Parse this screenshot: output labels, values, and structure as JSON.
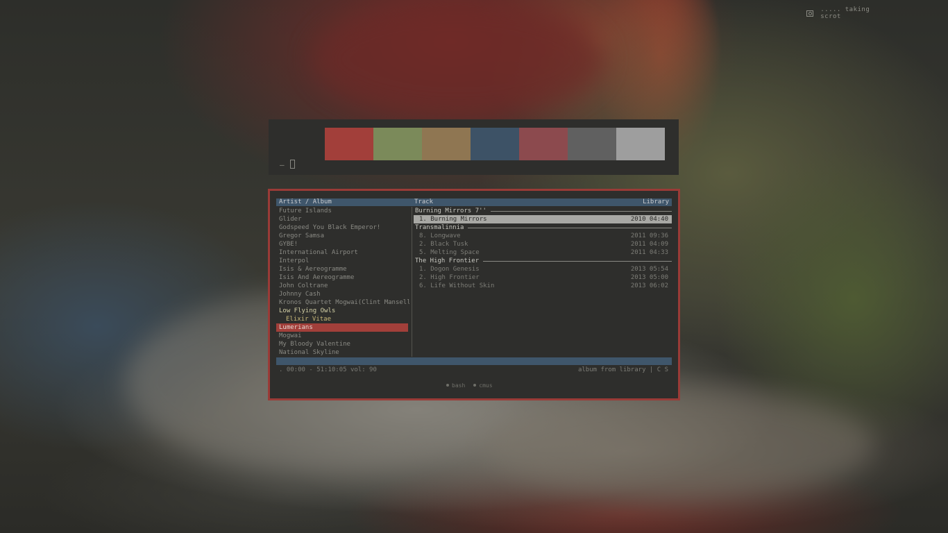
{
  "notice": {
    "text": "..... taking scrot",
    "icon": "camera-icon"
  },
  "palette": {
    "colors": [
      "#a23f3a",
      "#7b8a5a",
      "#8f7652",
      "#3d5266",
      "#8c4a4e",
      "#606060",
      "#9e9e9e"
    ],
    "prompt": "—"
  },
  "player": {
    "header": {
      "artist_album": "Artist / Album",
      "track": "Track",
      "view": "Library"
    },
    "artists": [
      "Future Islands",
      "Glider",
      "Godspeed You Black Emperor!",
      "Gregor Samsa",
      "GYBE!",
      "International Airport",
      "Interpol",
      "Isis & Aereogramme",
      "Isis And Aereogramme",
      "John Coltrane",
      "Johnny Cash",
      "Kronos Quartet  Mogwai(Clint Mansell",
      "Low Flying Owls",
      "Elixir Vitae",
      "Lumerians",
      "Mogwai",
      "My Bloody Valentine",
      "National Skyline"
    ],
    "albums": [
      {
        "title": "Burning Mirrors 7''",
        "tracks": [
          {
            "label": "1. Burning Mirrors",
            "meta": "2010 04:40"
          }
        ]
      },
      {
        "title": "Transmalinnia",
        "tracks": [
          {
            "label": "8. Longwave",
            "meta": "2011 09:36"
          },
          {
            "label": "2. Black Tusk",
            "meta": "2011 04:09"
          },
          {
            "label": "5. Melting Space",
            "meta": "2011 04:33"
          }
        ]
      },
      {
        "title": "The High Frontier",
        "tracks": [
          {
            "label": "1. Dogon Genesis",
            "meta": "2013 05:54"
          },
          {
            "label": "2. High Frontier",
            "meta": "2013 05:00"
          },
          {
            "label": "6. Life Without Skin",
            "meta": "2013 06:02"
          }
        ]
      }
    ],
    "status": {
      "left": ". 00:00 - 51:10:05 vol: 90",
      "right": "album from library | C  S"
    },
    "tabs": [
      "bash",
      "cmus"
    ]
  }
}
